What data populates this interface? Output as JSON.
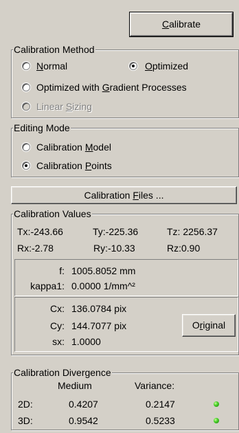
{
  "calibrate_button": {
    "pre": "",
    "accel": "C",
    "post": "alibrate"
  },
  "calibration_method": {
    "legend": "Calibration Method",
    "normal": {
      "accel": "N",
      "post": "ormal"
    },
    "optimized": {
      "accel": "O",
      "post": "ptimized"
    },
    "gradient": {
      "pre": "Optimized with ",
      "accel": "G",
      "post": "radient Processes"
    },
    "linear": {
      "pre": "Linear ",
      "accel": "S",
      "post": "izing"
    },
    "selected": "optimized"
  },
  "editing_mode": {
    "legend": "Editing Mode",
    "model": {
      "pre": "Calibration ",
      "accel": "M",
      "post": "odel"
    },
    "points": {
      "pre": "Calibration ",
      "accel": "P",
      "post": "oints"
    },
    "selected": "points"
  },
  "calibration_files_button": {
    "pre": "Calibration ",
    "accel": "F",
    "post": "iles ..."
  },
  "calibration_values": {
    "legend": "Calibration Values",
    "tx": "Tx:-243.66",
    "ty": "Ty:-225.36",
    "tz": "Tz: 2256.37",
    "rx": "Rx:-2.78",
    "ry": "Ry:-10.33",
    "rz": "Rz:0.90",
    "f_label": "f:",
    "f_value": "1005.8052 mm",
    "kappa_label": "kappa1:",
    "kappa_value": "0.0000  1/mm^²",
    "cx_label": "Cx:",
    "cx_value": "136.0784 pix",
    "cy_label": "Cy:",
    "cy_value": "144.7077 pix",
    "sx_label": "sx:",
    "sx_value": "1.0000",
    "original_button": {
      "pre": "O",
      "accel": "r",
      "post": "iginal"
    }
  },
  "calibration_divergence": {
    "legend": "Calibration Divergence",
    "col_medium": "Medium",
    "col_variance": "Variance:",
    "rows": [
      {
        "label": "2D:",
        "medium": "0.4207",
        "variance": "0.2147",
        "status": "green"
      },
      {
        "label": "3D:",
        "medium": "0.9542",
        "variance": "0.5233",
        "status": "green"
      }
    ]
  },
  "colors": {
    "face": "#d4d0c8",
    "led_ok": "#4bd12a"
  }
}
